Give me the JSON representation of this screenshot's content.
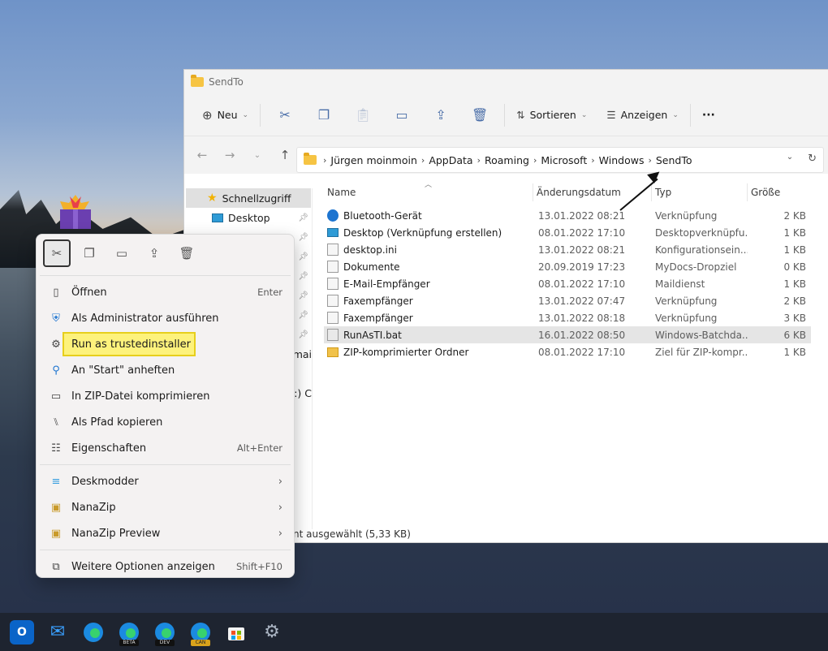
{
  "explorer": {
    "title": "SendTo",
    "toolbar": {
      "new_label": "Neu",
      "sort_label": "Sortieren",
      "view_label": "Anzeigen",
      "more_label": "···"
    },
    "breadcrumbs": [
      "Jürgen moinmoin",
      "AppData",
      "Roaming",
      "Microsoft",
      "Windows",
      "SendTo"
    ],
    "nav": {
      "quick_access": "Schnellzugriff",
      "desktop": "Desktop",
      "partial_1": "mai",
      "partial_2": ":) C"
    },
    "columns": [
      "Name",
      "Änderungsdatum",
      "Typ",
      "Größe"
    ],
    "files": [
      {
        "name": "Bluetooth-Gerät",
        "date": "13.01.2022 08:21",
        "type": "Verknüpfung",
        "size": "2 KB",
        "icon": "bluetooth-icon"
      },
      {
        "name": "Desktop (Verknüpfung erstellen)",
        "date": "08.01.2022 17:10",
        "type": "Desktopverknüpfu...",
        "size": "1 KB",
        "icon": "desktop-icon"
      },
      {
        "name": "desktop.ini",
        "date": "13.01.2022 08:21",
        "type": "Konfigurationsein...",
        "size": "1 KB",
        "icon": "ini-file-icon"
      },
      {
        "name": "Dokumente",
        "date": "20.09.2019 17:23",
        "type": "MyDocs-Dropziel",
        "size": "0 KB",
        "icon": "documents-icon"
      },
      {
        "name": "E-Mail-Empfänger",
        "date": "08.01.2022 17:10",
        "type": "Maildienst",
        "size": "1 KB",
        "icon": "mail-icon"
      },
      {
        "name": "Faxempfänger",
        "date": "13.01.2022 07:47",
        "type": "Verknüpfung",
        "size": "2 KB",
        "icon": "fax-icon"
      },
      {
        "name": "Faxempfänger",
        "date": "13.01.2022 08:18",
        "type": "Verknüpfung",
        "size": "3 KB",
        "icon": "fax-icon"
      },
      {
        "name": "RunAsTI.bat",
        "date": "16.01.2022 08:50",
        "type": "Windows-Batchda...",
        "size": "6 KB",
        "icon": "batch-file-icon"
      },
      {
        "name": "ZIP-komprimierter Ordner",
        "date": "08.01.2022 17:10",
        "type": "Ziel für ZIP-kompr...",
        "size": "1 KB",
        "icon": "zip-folder-icon"
      }
    ],
    "status": "nt ausgewählt (5,33 KB)"
  },
  "context_menu": {
    "items": [
      {
        "label": "Öffnen",
        "shortcut": "Enter"
      },
      {
        "label": "Als Administrator ausführen",
        "shortcut": ""
      },
      {
        "label": "Run as trustedinstaller",
        "shortcut": ""
      },
      {
        "label": "An \"Start\" anheften",
        "shortcut": ""
      },
      {
        "label": "In ZIP-Datei komprimieren",
        "shortcut": ""
      },
      {
        "label": "Als Pfad kopieren",
        "shortcut": ""
      },
      {
        "label": "Eigenschaften",
        "shortcut": "Alt+Enter"
      }
    ],
    "submenus": [
      {
        "label": "Deskmodder"
      },
      {
        "label": "NanaZip"
      },
      {
        "label": "NanaZip Preview"
      }
    ],
    "more": {
      "label": "Weitere Optionen anzeigen",
      "shortcut": "Shift+F10"
    }
  },
  "taskbar": {
    "badges": [
      "BETA",
      "DEV",
      "CAN"
    ]
  },
  "colors": {
    "highlight": "#fdf27c",
    "accent": "#1d74d0"
  }
}
